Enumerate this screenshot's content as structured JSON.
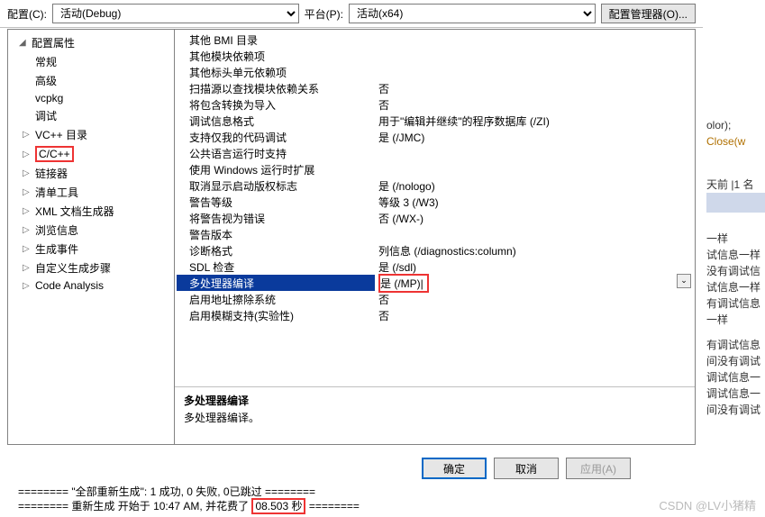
{
  "topbar": {
    "config_label": "配置(C):",
    "config_value": "活动(Debug)",
    "platform_label": "平台(P):",
    "platform_value": "活动(x64)",
    "manager_button": "配置管理器(O)..."
  },
  "tree": {
    "root": "配置属性",
    "items": [
      {
        "label": "常规",
        "expand": false
      },
      {
        "label": "高级",
        "expand": false
      },
      {
        "label": "vcpkg",
        "expand": false
      },
      {
        "label": "调试",
        "expand": false
      },
      {
        "label": "VC++ 目录",
        "expand": true
      },
      {
        "label": "C/C++",
        "expand": true,
        "red": true
      },
      {
        "label": "链接器",
        "expand": true
      },
      {
        "label": "清单工具",
        "expand": true
      },
      {
        "label": "XML 文档生成器",
        "expand": true
      },
      {
        "label": "浏览信息",
        "expand": true
      },
      {
        "label": "生成事件",
        "expand": true
      },
      {
        "label": "自定义生成步骤",
        "expand": true
      },
      {
        "label": "Code Analysis",
        "expand": true
      }
    ]
  },
  "grid": [
    {
      "k": "其他 BMI 目录",
      "v": ""
    },
    {
      "k": "其他模块依赖项",
      "v": ""
    },
    {
      "k": "其他标头单元依赖项",
      "v": ""
    },
    {
      "k": "扫描源以查找模块依赖关系",
      "v": "否"
    },
    {
      "k": "将包含转换为导入",
      "v": "否"
    },
    {
      "k": "调试信息格式",
      "v": "用于\"编辑并继续\"的程序数据库 (/ZI)"
    },
    {
      "k": "支持仅我的代码调试",
      "v": "是 (/JMC)"
    },
    {
      "k": "公共语言运行时支持",
      "v": ""
    },
    {
      "k": "使用 Windows 运行时扩展",
      "v": ""
    },
    {
      "k": "取消显示启动版权标志",
      "v": "是 (/nologo)"
    },
    {
      "k": "警告等级",
      "v": "等级 3 (/W3)"
    },
    {
      "k": "将警告视为错误",
      "v": "否 (/WX-)"
    },
    {
      "k": "警告版本",
      "v": ""
    },
    {
      "k": "诊断格式",
      "v": "列信息 (/diagnostics:column)"
    },
    {
      "k": "SDL 检查",
      "v": "是 (/sdl)"
    },
    {
      "k": "多处理器编译",
      "v": "是 (/MP)",
      "selected": true,
      "red": true
    },
    {
      "k": "启用地址擦除系统",
      "v": "否"
    },
    {
      "k": "启用模糊支持(实验性)",
      "v": "否"
    }
  ],
  "desc": {
    "title": "多处理器编译",
    "text": "多处理器编译。"
  },
  "buttons": {
    "ok": "确定",
    "cancel": "取消",
    "apply": "应用(A)"
  },
  "output": {
    "line1_a": "======== \"全部重新生成\": 1 成功, 0 失败, 0已跳过 ========",
    "line2_a": "======== 重新生成 开始于 10:47 AM, 并花费了 ",
    "line2_b": "08.503 秒",
    "line2_c": " ========"
  },
  "rightbg": {
    "l1": "olor);",
    "l2": "Close(w",
    "l3": "天前 |1 名",
    "l4": "一样",
    "l5": "试信息一样",
    "l6": "没有调试信",
    "l7": "试信息一样",
    "l8": "有调试信息",
    "l9": "一样",
    "l10": "有调试信息",
    "l11": "间没有调试",
    "l12": "调试信息一",
    "l13": "调试信息一",
    "l14": "间没有调试"
  },
  "watermark": "CSDN @LV小猪精"
}
